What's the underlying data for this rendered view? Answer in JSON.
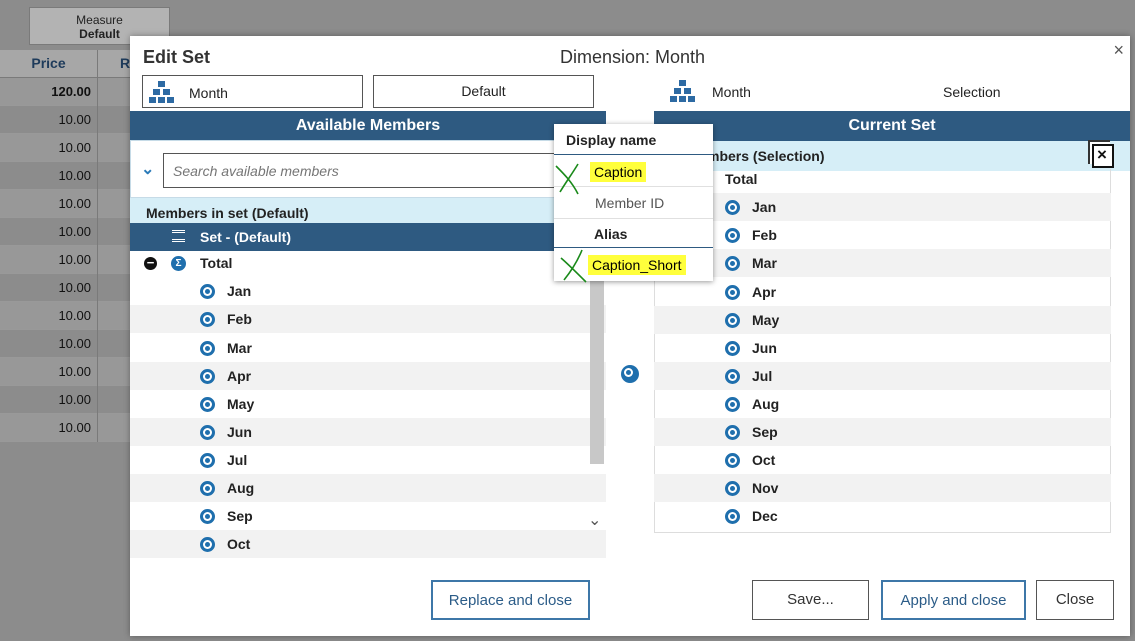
{
  "background": {
    "measure_label": "Measure",
    "measure_value": "Default",
    "col_price": "Price",
    "col_r": "R",
    "values": [
      "120.00",
      "10.00",
      "10.00",
      "10.00",
      "10.00",
      "10.00",
      "10.00",
      "10.00",
      "10.00",
      "10.00",
      "10.00",
      "10.00",
      "10.00"
    ]
  },
  "dialog": {
    "title": "Edit Set",
    "dimension": "Dimension: Month",
    "close_glyph": "×",
    "left": {
      "hierarchy": "Month",
      "view": "Default",
      "header": "Available Members",
      "search_placeholder": "Search available members",
      "members_header": "Members in set (Default)",
      "set_label": "Set - (Default)",
      "total_label": "Total",
      "months": [
        "Jan",
        "Feb",
        "Mar",
        "Apr",
        "May",
        "Jun",
        "Jul",
        "Aug",
        "Sep",
        "Oct"
      ]
    },
    "right": {
      "hierarchy": "Month",
      "mode": "Selection",
      "header": "Current Set",
      "members_header": "mbers (Selection)",
      "total_label": "Total",
      "months": [
        "Jan",
        "Feb",
        "Mar",
        "Apr",
        "May",
        "Jun",
        "Jul",
        "Aug",
        "Sep",
        "Oct",
        "Nov",
        "Dec"
      ]
    },
    "buttons": {
      "replace": "Replace and close",
      "save": "Save...",
      "apply": "Apply and close",
      "close": "Close"
    }
  },
  "popup": {
    "display_name_header": "Display name",
    "caption": "Caption",
    "member_id": "Member ID",
    "alias_header": "Alias",
    "caption_short": "Caption_Short"
  },
  "colors": {
    "header_blue": "#2e5a81",
    "light_blue": "#d6eef7",
    "bullet_blue": "#1f6fad",
    "highlight": "#ffff3c",
    "check_green": "#1a8a1a"
  }
}
